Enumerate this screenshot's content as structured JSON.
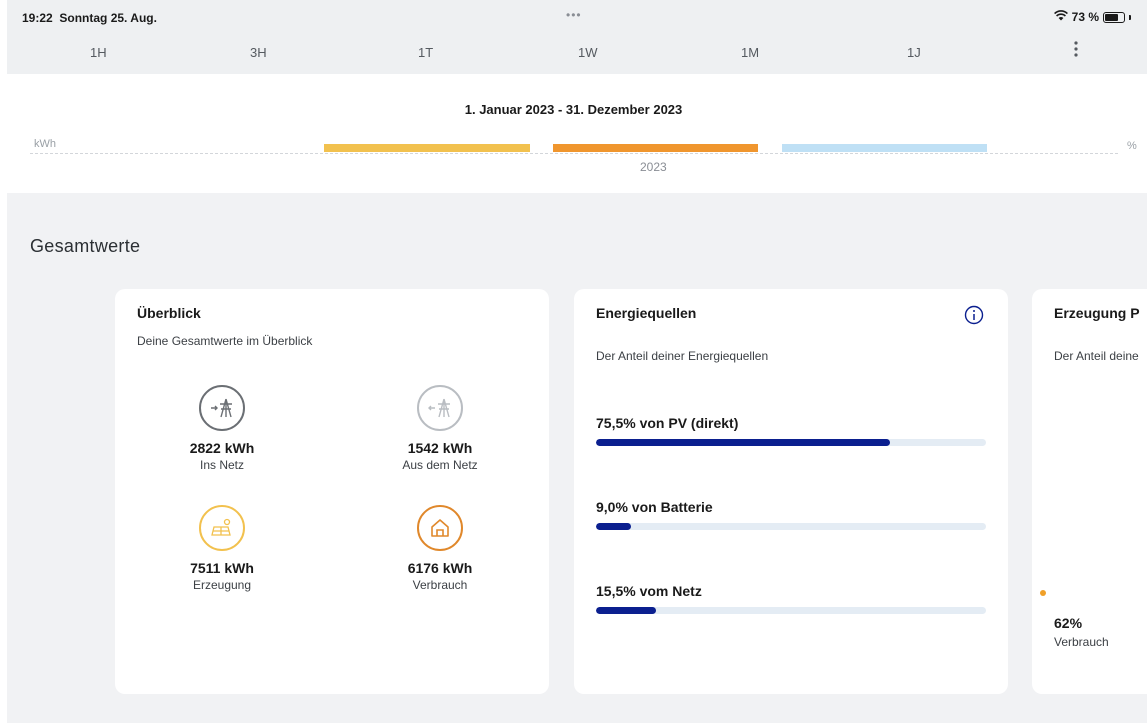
{
  "status_bar": {
    "time": "19:22",
    "date": "Sonntag 25. Aug.",
    "dots": "•••",
    "battery_text": "73 %",
    "battery_level": 0.73
  },
  "range_tabs": [
    "1H",
    "3H",
    "1T",
    "1W",
    "1M",
    "1J"
  ],
  "more_icon": "more-vertical-icon",
  "date_range": "1. Januar 2023 - 31. Dezember 2023",
  "chart": {
    "unit_left": "kWh",
    "unit_right": "%",
    "x_label": "2023",
    "bar_colors": [
      "#f2c14e",
      "#f0962e",
      "#bfe0f5"
    ]
  },
  "section_title": "Gesamtwerte",
  "overview": {
    "title": "Überblick",
    "subtitle": "Deine Gesamtwerte im Überblick",
    "metrics": [
      {
        "value": "2822 kWh",
        "label": "Ins Netz",
        "icon": "grid-export-icon",
        "color": "#6b6f74"
      },
      {
        "value": "1542 kWh",
        "label": "Aus dem Netz",
        "icon": "grid-import-icon",
        "color": "#b9bdc2"
      },
      {
        "value": "7511 kWh",
        "label": "Erzeugung",
        "icon": "solar-panel-icon",
        "color": "#f2c14e"
      },
      {
        "value": "6176 kWh",
        "label": "Verbrauch",
        "icon": "house-icon",
        "color": "#e0882b"
      }
    ]
  },
  "sources": {
    "title": "Energiequellen",
    "subtitle": "Der Anteil deiner Energiequellen",
    "info_icon": "info-icon",
    "items": [
      {
        "label": "75,5% von PV (direkt)",
        "value": 75.5
      },
      {
        "label": "9,0% von Batterie",
        "value": 9.0
      },
      {
        "label": "15,5% vom Netz",
        "value": 15.5
      }
    ]
  },
  "production": {
    "title": "Erzeugung P",
    "subtitle": "Der Anteil deine",
    "legend_value": "62%",
    "legend_label": "Verbrauch",
    "legend_color": "#f0a028"
  }
}
